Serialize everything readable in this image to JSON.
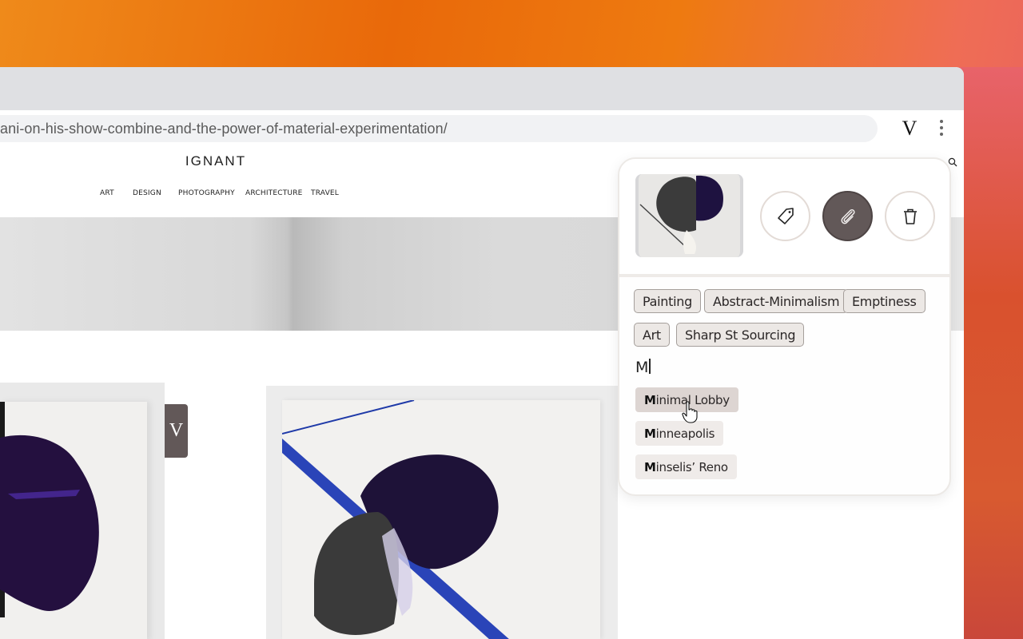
{
  "browser": {
    "url": "ani-on-his-show-combine-and-the-power-of-material-experimentation/",
    "extension_icon": "V",
    "menu_icon": "kebab-menu-icon"
  },
  "site": {
    "logo": "IGNANT",
    "nav": [
      "ART",
      "DESIGN",
      "PHOTOGRAPHY",
      "ARCHITECTURE",
      "TRAVEL"
    ],
    "search_icon": "search-icon",
    "side_tab_label": "V"
  },
  "popup": {
    "actions": [
      {
        "name": "tag",
        "icon": "tag-icon",
        "active": false
      },
      {
        "name": "attach",
        "icon": "paperclip-icon",
        "active": true
      },
      {
        "name": "delete",
        "icon": "trash-icon",
        "active": false
      }
    ],
    "tags": [
      "Painting",
      "Abstract-Minimalism",
      "Emptiness",
      "Art",
      "Sharp St Sourcing"
    ],
    "input_value": "M",
    "suggestions": [
      {
        "match": "M",
        "rest": "inimal Lobby",
        "hovered": true
      },
      {
        "match": "M",
        "rest": "inneapolis",
        "hovered": false
      },
      {
        "match": "M",
        "rest": "inselis’ Reno",
        "hovered": false
      }
    ]
  },
  "colors": {
    "accent": "#625858",
    "tag_bg": "#ece8e5",
    "tag_border": "#a59f9b",
    "suggestion_hover": "#ddd5d2"
  }
}
